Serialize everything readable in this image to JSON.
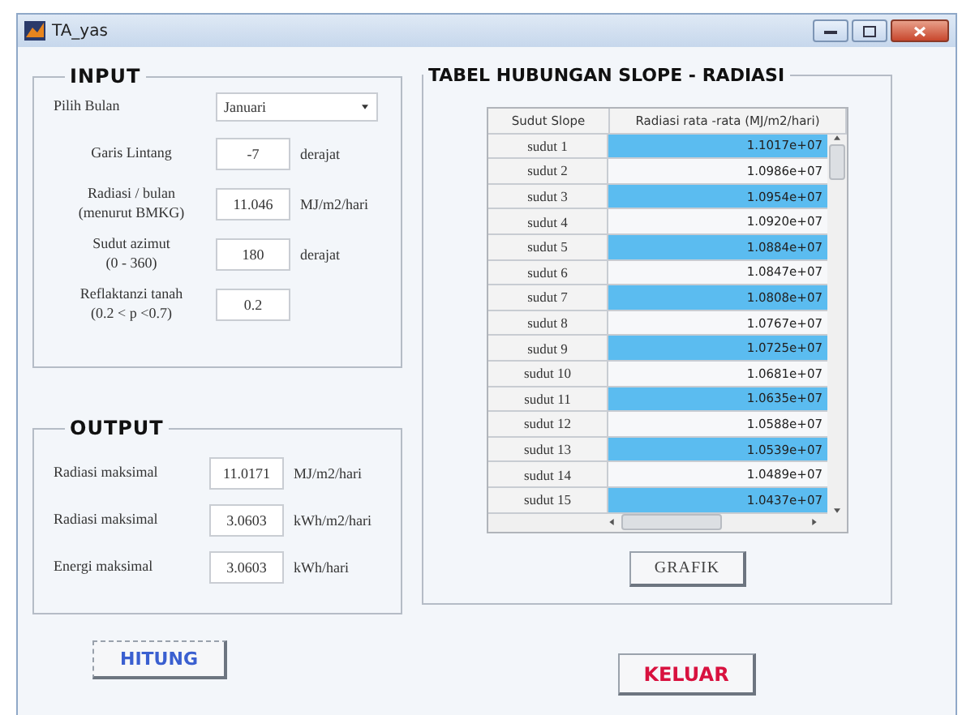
{
  "window": {
    "title": "TA_yas"
  },
  "input_panel": {
    "title": "INPUT",
    "month": {
      "label": "Pilih Bulan",
      "value": "Januari"
    },
    "fields": [
      {
        "label": "Garis Lintang",
        "value": "-7",
        "unit": "derajat"
      },
      {
        "label": "Radiasi / bulan\n(menurut BMKG)",
        "value": "11.046",
        "unit": "MJ/m2/hari"
      },
      {
        "label": "Sudut azimut\n(0 - 360)",
        "value": "180",
        "unit": "derajat"
      },
      {
        "label": "Reflaktanzi tanah\n(0.2 < p <0.7)",
        "value": "0.2"
      }
    ]
  },
  "output_panel": {
    "title": "OUTPUT",
    "fields": [
      {
        "label": "Radiasi maksimal",
        "value": "11.0171",
        "unit": "MJ/m2/hari"
      },
      {
        "label": "Radiasi maksimal",
        "value": "3.0603",
        "unit": "kWh/m2/hari"
      },
      {
        "label": "Energi maksimal",
        "value": "3.0603",
        "unit": "kWh/hari"
      }
    ]
  },
  "table_panel": {
    "title": "TABEL HUBUNGAN SLOPE - RADIASI",
    "table": {
      "columns": [
        "Sudut Slope",
        "Radiasi rata -rata (MJ/m2/hari)"
      ],
      "rows": [
        [
          "sudut 1",
          "1.1017e+07"
        ],
        [
          "sudut 2",
          "1.0986e+07"
        ],
        [
          "sudut 3",
          "1.0954e+07"
        ],
        [
          "sudut 4",
          "1.0920e+07"
        ],
        [
          "sudut 5",
          "1.0884e+07"
        ],
        [
          "sudut 6",
          "1.0847e+07"
        ],
        [
          "sudut 7",
          "1.0808e+07"
        ],
        [
          "sudut 8",
          "1.0767e+07"
        ],
        [
          "sudut 9",
          "1.0725e+07"
        ],
        [
          "sudut 10",
          "1.0681e+07"
        ],
        [
          "sudut 11",
          "1.0635e+07"
        ],
        [
          "sudut 12",
          "1.0588e+07"
        ],
        [
          "sudut 13",
          "1.0539e+07"
        ],
        [
          "sudut 14",
          "1.0489e+07"
        ],
        [
          "sudut 15",
          "1.0437e+07"
        ]
      ]
    },
    "button": "GRAFIK"
  },
  "buttons": {
    "calculate": "HITUNG",
    "exit": "KELUAR"
  }
}
